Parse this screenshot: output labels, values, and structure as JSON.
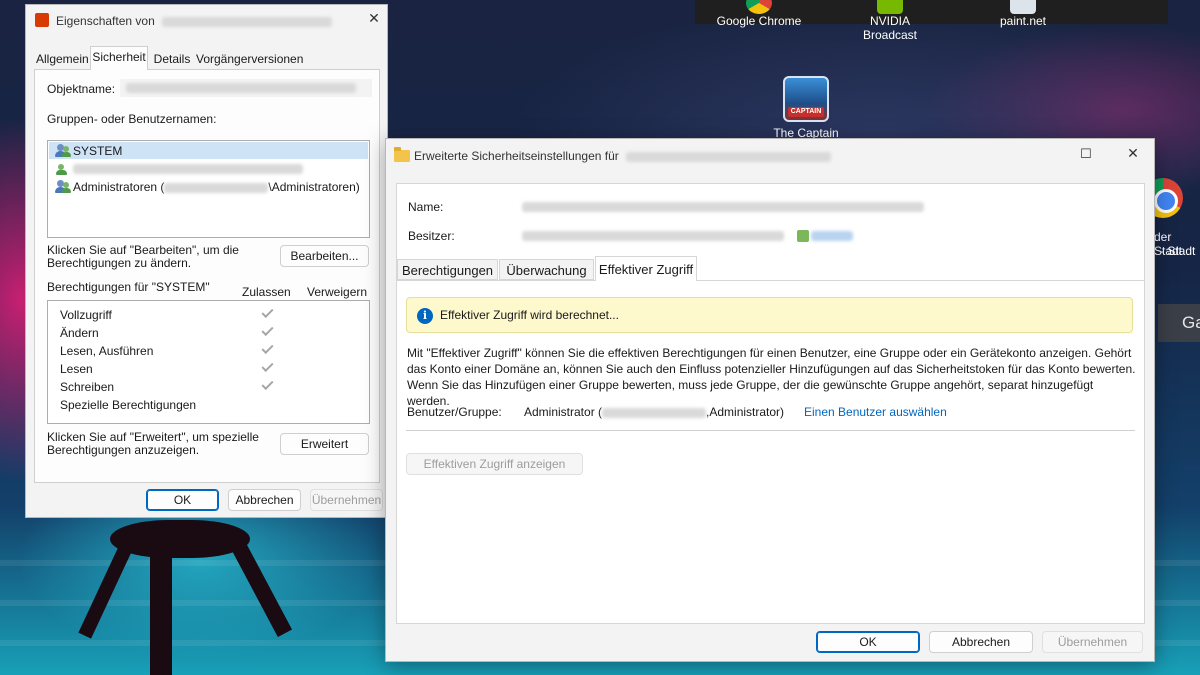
{
  "taskbar": {
    "items": [
      {
        "label": "Google Chrome",
        "icon": "chrome-icon"
      },
      {
        "label": "NVIDIA Broadcast",
        "icon": "nvidia-broadcast-icon"
      },
      {
        "label": "paint.net",
        "icon": "paint-net-icon"
      }
    ]
  },
  "desktop": {
    "captain_label": "The Captain",
    "right_icon_text_1": "der Stadt",
    "right_icon_text_2": "- Stadt",
    "right_partial_text": "Ga"
  },
  "props_dialog": {
    "title": "Eigenschaften von",
    "tabs": [
      {
        "label": "Allgemein",
        "active": false
      },
      {
        "label": "Sicherheit",
        "active": true
      },
      {
        "label": "Details",
        "active": false
      },
      {
        "label": "Vorgängerversionen",
        "active": false
      }
    ],
    "object_name_label": "Objektname:",
    "groups_label": "Gruppen- oder Benutzernamen:",
    "groups": [
      {
        "name": "SYSTEM",
        "suffix": ""
      },
      {
        "name": "",
        "suffix": ""
      },
      {
        "name": "Administratoren (",
        "suffix": "\\Administratoren)"
      }
    ],
    "edit_hint": "Klicken Sie auf \"Bearbeiten\", um die Berechtigungen zu ändern.",
    "edit_button": "Bearbeiten...",
    "permissions_for": "Berechtigungen für \"SYSTEM\"",
    "allow_header": "Zulassen",
    "deny_header": "Verweigern",
    "permissions": [
      {
        "name": "Vollzugriff",
        "allow": true
      },
      {
        "name": "Ändern",
        "allow": true
      },
      {
        "name": "Lesen, Ausführen",
        "allow": true
      },
      {
        "name": "Lesen",
        "allow": true
      },
      {
        "name": "Schreiben",
        "allow": true
      },
      {
        "name": "Spezielle Berechtigungen",
        "allow": false
      }
    ],
    "advanced_hint": "Klicken Sie auf \"Erweitert\", um spezielle Berechtigungen anzuzeigen.",
    "advanced_button": "Erweitert",
    "ok": "OK",
    "cancel": "Abbrechen",
    "apply": "Übernehmen"
  },
  "adv_dialog": {
    "title": "Erweiterte Sicherheitseinstellungen für",
    "name_label": "Name:",
    "owner_label": "Besitzer:",
    "tabs": [
      {
        "label": "Berechtigungen",
        "active": false
      },
      {
        "label": "Überwachung",
        "active": false
      },
      {
        "label": "Effektiver Zugriff",
        "active": true
      }
    ],
    "info_text": "Effektiver Zugriff wird berechnet...",
    "description": "Mit \"Effektiver Zugriff\" können Sie die effektiven Berechtigungen für einen Benutzer, eine Gruppe oder ein Gerätekonto anzeigen. Gehört das Konto einer Domäne an, können Sie auch den Einfluss potenzieller Hinzufügungen auf das Sicherheitstoken für das Konto bewerten. Wenn Sie das Hinzufügen einer Gruppe bewerten, muss jede Gruppe, der die gewünschte Gruppe angehört, separat hinzugefügt werden.",
    "user_group_label": "Benutzer/Gruppe:",
    "user_value_prefix": "Administrator (",
    "user_value_suffix": ",Administrator)",
    "select_user_link": "Einen Benutzer auswählen",
    "view_access_button": "Effektiven Zugriff anzeigen",
    "ok": "OK",
    "cancel": "Abbrechen",
    "apply": "Übernehmen"
  }
}
